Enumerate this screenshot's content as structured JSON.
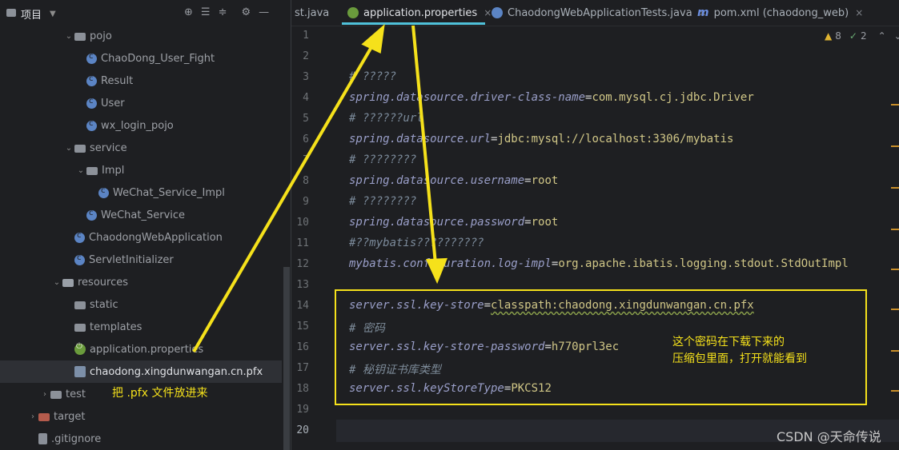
{
  "project_panel": {
    "title": "项目",
    "tree": [
      {
        "label": "pojo",
        "kind": "folder",
        "indent": 1,
        "arrow": "⌄"
      },
      {
        "label": "ChaoDong_User_Fight",
        "kind": "class",
        "indent": 2
      },
      {
        "label": "Result",
        "kind": "class",
        "indent": 2
      },
      {
        "label": "User",
        "kind": "class",
        "indent": 2
      },
      {
        "label": "wx_login_pojo",
        "kind": "class",
        "indent": 2
      },
      {
        "label": "service",
        "kind": "folder",
        "indent": 1,
        "arrow": "⌄"
      },
      {
        "label": "Impl",
        "kind": "folder",
        "indent": 2,
        "arrow": "⌄"
      },
      {
        "label": "WeChat_Service_Impl",
        "kind": "class",
        "indent": 3
      },
      {
        "label": "WeChat_Service",
        "kind": "interface",
        "indent": 2
      },
      {
        "label": "ChaodongWebApplication",
        "kind": "app",
        "indent": 1
      },
      {
        "label": "ServletInitializer",
        "kind": "class",
        "indent": 1
      },
      {
        "label": "resources",
        "kind": "resfolder",
        "indent": 0,
        "arrow": "⌄"
      },
      {
        "label": "static",
        "kind": "folder",
        "indent": 1
      },
      {
        "label": "templates",
        "kind": "folder",
        "indent": 1
      },
      {
        "label": "application.properties",
        "kind": "props",
        "indent": 1
      },
      {
        "label": "chaodong.xingdunwangan.cn.pfx",
        "kind": "pfx",
        "indent": 1,
        "selected": true
      },
      {
        "label": "test",
        "kind": "folder",
        "indent": -1,
        "arrow": "›"
      },
      {
        "label": "target",
        "kind": "target",
        "indent": -2,
        "arrow": "›"
      },
      {
        "label": ".gitignore",
        "kind": "gitignore",
        "indent": -2
      }
    ]
  },
  "tabs": [
    {
      "label": "st.java",
      "icon": "none"
    },
    {
      "label": "application.properties",
      "icon": "green",
      "active": true
    },
    {
      "label": "ChaodongWebApplicationTests.java",
      "icon": "blue"
    },
    {
      "label": "pom.xml (chaodong_web)",
      "icon": "m"
    }
  ],
  "inspections": {
    "warnings": "8",
    "checks": "2"
  },
  "editor": {
    "line_numbers": [
      "1",
      "2",
      "3",
      "4",
      "5",
      "6",
      "7",
      "8",
      "9",
      "10",
      "11",
      "12",
      "13",
      "14",
      "15",
      "16",
      "17",
      "18",
      "19",
      "20"
    ],
    "lines": [
      {
        "no": 3,
        "type": "comment",
        "text": "# ?????"
      },
      {
        "no": 4,
        "type": "prop",
        "key": "spring.datasource.driver-class-name",
        "value": "com.mysql.cj.jdbc.Driver"
      },
      {
        "no": 5,
        "type": "comment",
        "text": "# ??????url"
      },
      {
        "no": 6,
        "type": "prop",
        "key": "spring.datasource.url",
        "value": "jdbc:mysql://localhost:3306/mybatis"
      },
      {
        "no": 7,
        "type": "comment",
        "text": "# ????????"
      },
      {
        "no": 8,
        "type": "prop",
        "key": "spring.datasource.username",
        "value": "root"
      },
      {
        "no": 9,
        "type": "comment",
        "text": "# ????????"
      },
      {
        "no": 10,
        "type": "prop",
        "key": "spring.datasource.password",
        "value": "root"
      },
      {
        "no": 11,
        "type": "comment",
        "text": "#??mybatis??????????"
      },
      {
        "no": 12,
        "type": "prop",
        "key": "mybatis.configuration.log-impl",
        "value": "org.apache.ibatis.logging.stdout.StdOutImpl"
      },
      {
        "no": 14,
        "type": "prop",
        "key": "server.ssl.key-store",
        "value": "classpath:chaodong.xingdunwangan.cn.pfx"
      },
      {
        "no": 15,
        "type": "comment",
        "text": "# 密码"
      },
      {
        "no": 16,
        "type": "prop",
        "key": "server.ssl.key-store-password",
        "value": "h770prl3ec"
      },
      {
        "no": 17,
        "type": "comment",
        "text": "# 秘钥证书库类型"
      },
      {
        "no": 18,
        "type": "prop",
        "key": "server.ssl.keyStoreType",
        "value": "PKCS12"
      }
    ]
  },
  "annotations": {
    "put_pfx": "把 .pfx 文件放进来",
    "password_note_line1": "这个密码在下载下来的",
    "password_note_line2": "压缩包里面，打开就能看到",
    "watermark": "CSDN @天命传说"
  },
  "colors": {
    "annotation": "#f5e11b",
    "active_tab_underline": "#4fc1d9"
  }
}
